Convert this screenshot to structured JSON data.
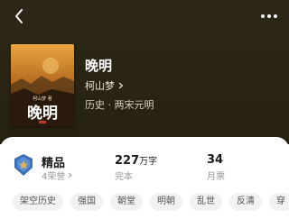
{
  "book": {
    "title": "晚明",
    "author": "柯山梦",
    "genre": "历史 · 两宋元明",
    "cover": {
      "title": "晚明",
      "subtitle": "柯山梦 著"
    }
  },
  "stats": {
    "quality": {
      "value": "精品",
      "label": "4荣誉"
    },
    "words": {
      "number": "227",
      "unit": "万字",
      "label": "完本"
    },
    "votes": {
      "value": "34",
      "label": "月票"
    }
  },
  "tags": [
    "架空历史",
    "强国",
    "朝堂",
    "明朝",
    "乱世",
    "反清",
    "穿"
  ],
  "colors": {
    "hero_bg": "#2d2716",
    "badge_blue": "#3b6fb6",
    "badge_gold": "#d9b55a"
  },
  "icons": {
    "back": "chevron-left-icon",
    "more": "more-dots-icon",
    "badge": "quality-medal-icon"
  }
}
